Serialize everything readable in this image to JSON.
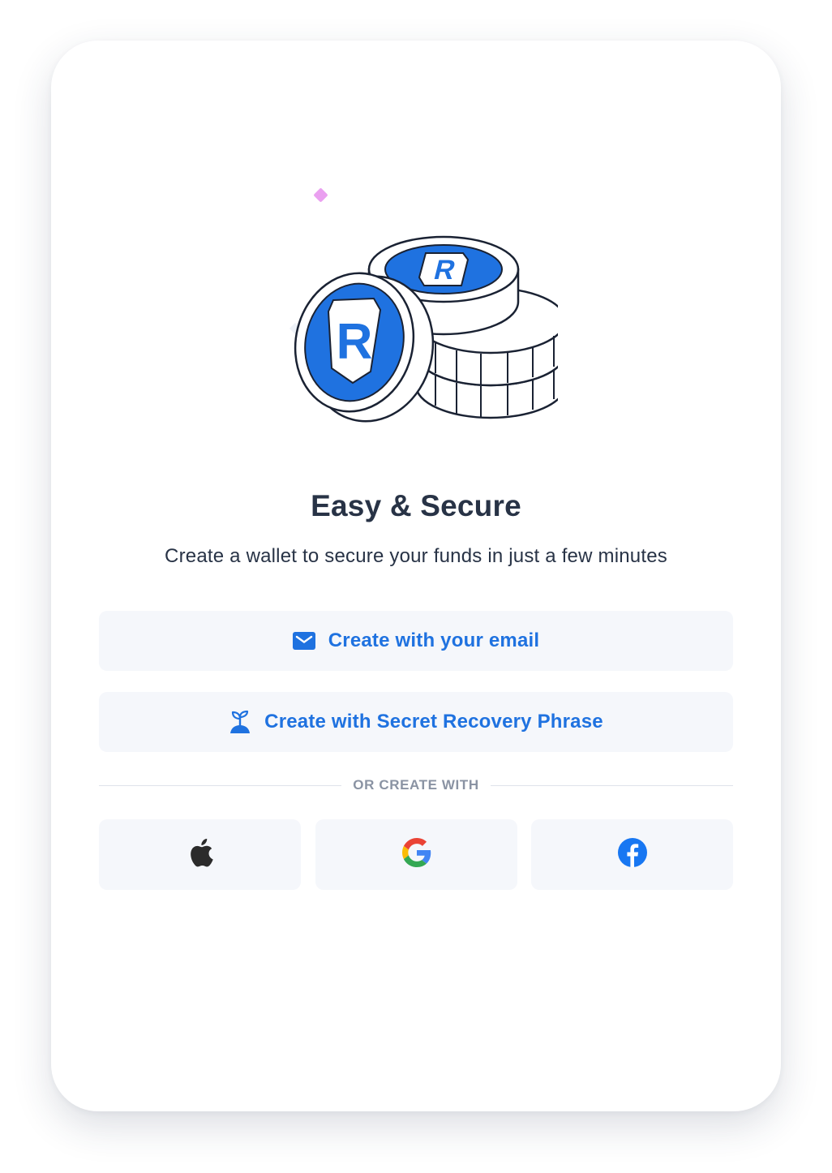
{
  "header": {
    "title": "Easy & Secure",
    "subtitle": "Create a wallet to secure your funds in just a few minutes"
  },
  "illustration": {
    "icon": "coins-stack-illustration",
    "accent": "#1f72e0",
    "sparkle": "#eaa0f0"
  },
  "actions": {
    "email_label": "Create with your email",
    "email_icon": "mail-icon",
    "phrase_label": "Create with Secret Recovery Phrase",
    "phrase_icon": "sprout-icon"
  },
  "divider": {
    "label": "OR CREATE WITH"
  },
  "social": [
    {
      "name": "apple",
      "icon": "apple-icon",
      "color": "#2b2b2b"
    },
    {
      "name": "google",
      "icon": "google-icon",
      "color": "#4285f4"
    },
    {
      "name": "facebook",
      "icon": "facebook-icon",
      "color": "#1877f2"
    }
  ],
  "colors": {
    "primary": "#1f72e0",
    "text": "#283346",
    "muted": "#8a93a3",
    "button_bg": "#f5f7fb"
  }
}
